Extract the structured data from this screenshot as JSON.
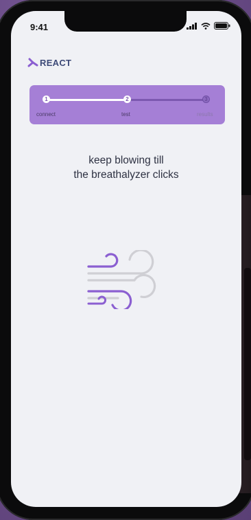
{
  "status_bar": {
    "time": "9:41"
  },
  "brand": {
    "name": "REACT"
  },
  "progress": {
    "steps": [
      {
        "number": "1",
        "label": "connect",
        "state": "done"
      },
      {
        "number": "2",
        "label": "test",
        "state": "active"
      },
      {
        "number": "3",
        "label": "results",
        "state": "pending"
      }
    ]
  },
  "instruction": {
    "line1": "keep blowing till",
    "line2": "the breathalyzer clicks"
  },
  "icons": {
    "main": "wind-icon"
  },
  "colors": {
    "accent": "#a57fd6",
    "accent_dark": "#8b5fd1",
    "brand_text": "#3d4a78",
    "screen_bg": "#f0f1f5",
    "wind_gray": "#cfcfd4"
  }
}
